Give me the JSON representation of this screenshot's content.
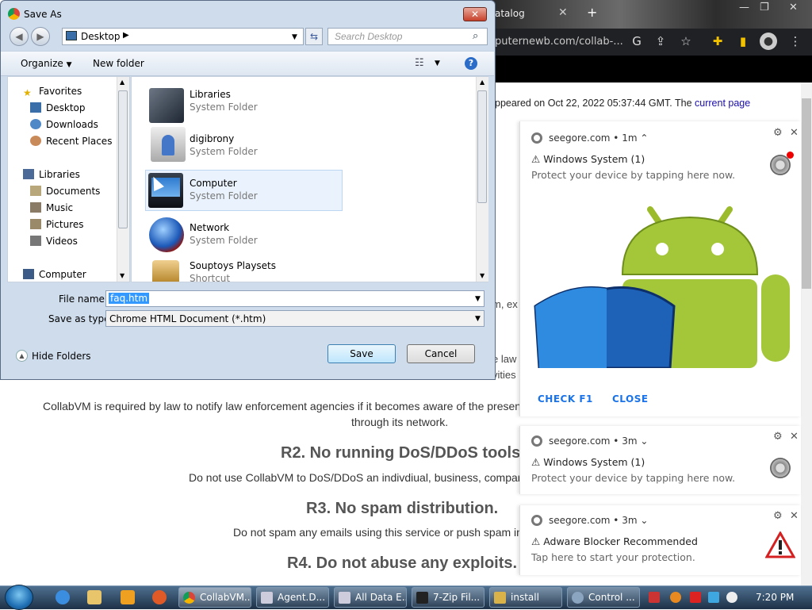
{
  "browser": {
    "tab_fragment": "atalog",
    "url_fragment": "puternewb.com/collab-...",
    "appeared_text": "ppeared on Oct 22, 2022 05:37:44 GMT. The ",
    "appeared_link": "current page",
    "frag_m_ex": "m, ex",
    "frag_law": "e law",
    "frag_vities": "vities",
    "notify_text": "CollabVM is required by law to notify law enforcement agencies if it becomes aware of the presen",
    "notify_text2": "through its network.",
    "r2_title": "R2. No running DoS/DDoS tools.",
    "r2_text": "Do not use CollabVM to DoS/DDoS an indivdiual, business, compan",
    "r3_title": "R3. No spam distribution.",
    "r3_text": "Do not spam any emails using this service or push spam in",
    "r4_title": "R4. Do not abuse any exploits."
  },
  "notifications": [
    {
      "source": "seegore.com",
      "time": "1m",
      "chev": "⌃",
      "title": "Windows System (1)",
      "message": "Protect your device by tapping here now.",
      "btn1": "CHECK F1",
      "btn2": "CLOSE"
    },
    {
      "source": "seegore.com",
      "time": "3m",
      "chev": "⌄",
      "title": "Windows System (1)",
      "message": "Protect your device by tapping here now."
    },
    {
      "source": "seegore.com",
      "time": "3m",
      "chev": "⌄",
      "title": "Adware Blocker Recommended",
      "message": "Tap here to start your protection."
    }
  ],
  "dialog": {
    "title": "Save As",
    "location": "Desktop",
    "search_placeholder": "Search Desktop",
    "organize": "Organize",
    "new_folder": "New folder",
    "nav": {
      "favorites": "Favorites",
      "desktop": "Desktop",
      "downloads": "Downloads",
      "recent": "Recent Places",
      "libraries": "Libraries",
      "documents": "Documents",
      "music": "Music",
      "pictures": "Pictures",
      "videos": "Videos",
      "computer": "Computer"
    },
    "files": [
      {
        "name": "Libraries",
        "type": "System Folder"
      },
      {
        "name": "digibrony",
        "type": "System Folder"
      },
      {
        "name": "Computer",
        "type": "System Folder"
      },
      {
        "name": "Network",
        "type": "System Folder"
      },
      {
        "name": "Souptoys Playsets",
        "type": "Shortcut"
      }
    ],
    "file_name_label": "File name:",
    "file_name_value": "faq.htm",
    "save_type_label": "Save as type:",
    "save_type_value": "Chrome HTML Document (*.htm)",
    "hide_folders": "Hide Folders",
    "save": "Save",
    "cancel": "Cancel"
  },
  "taskbar": {
    "tasks": [
      "CollabVM...",
      "Agent.D...",
      "All Data E...",
      "7-Zip Fil...",
      "install",
      "Control ..."
    ],
    "clock": "7:20 PM"
  }
}
